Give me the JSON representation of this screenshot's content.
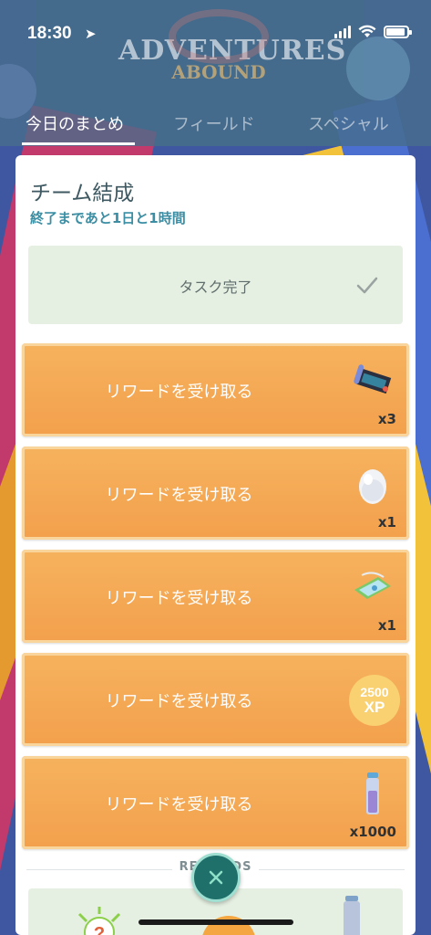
{
  "status_bar": {
    "time": "18:30"
  },
  "banner": {
    "logo_line1": "ADVENTURES",
    "logo_line2": "ABOUND"
  },
  "tabs": [
    {
      "label": "今日のまとめ",
      "active": true
    },
    {
      "label": "フィールド",
      "active": false
    },
    {
      "label": "スペシャル",
      "active": false
    }
  ],
  "quest": {
    "title": "チーム結成",
    "timer": "終了まであと1日と1時間",
    "task_done_label": "タスク完了"
  },
  "rewards": [
    {
      "label": "リワードを受け取る",
      "quantity": "x3",
      "icon": "map-scroll-icon"
    },
    {
      "label": "リワードを受け取る",
      "quantity": "x1",
      "icon": "egg-icon"
    },
    {
      "label": "リワードを受け取る",
      "quantity": "x1",
      "icon": "ticket-icon"
    },
    {
      "label": "リワードを受け取る",
      "quantity": "",
      "icon": "xp-badge-icon",
      "badge_top": "2500",
      "badge_bottom": "XP"
    },
    {
      "label": "リワードを受け取る",
      "quantity": "x1000",
      "icon": "stardust-vial-icon"
    }
  ],
  "rewards_section": {
    "label": "REWARDS"
  },
  "colors": {
    "reward_button": "#f3a04c",
    "task_done_bg": "#e6f0e2",
    "timer_text": "#3b8ea3",
    "close_button": "#1f6f6a"
  }
}
